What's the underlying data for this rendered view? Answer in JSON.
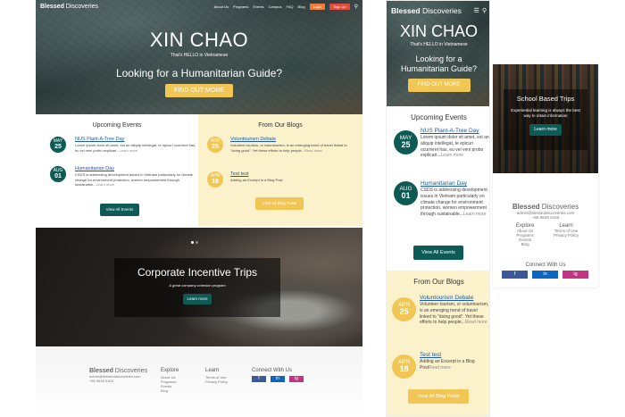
{
  "brand": {
    "bold": "Blessed",
    "light": " Discoveries"
  },
  "nav": {
    "items": [
      "About Us",
      "Programs",
      "Events",
      "Campus",
      "FAQ",
      "Blog"
    ],
    "login": "Login",
    "signup": "Sign Up"
  },
  "hero": {
    "title": "XIN CHAO",
    "subtitle": "That's HELLO in Vietnamese",
    "question": "Looking for a Humanitarian Guide?",
    "cta": "FIND OUT MORE"
  },
  "events": {
    "heading": "Upcoming Events",
    "items": [
      {
        "month": "MAY",
        "day": "25",
        "title": "NUS Plant-A-Tree Day",
        "text": "Lorem ipsum dolor sit amet, est an aliquip intellegat, te epicuri ocurreret has, eu vel veni probo explicari...",
        "more": "Learn more"
      },
      {
        "month": "AUG",
        "day": "01",
        "title": "Humanitarian Day",
        "text": "CSDS is addressing development issues in Vietnam particularly on climate change for environment protection, women empowerment through sustainable...",
        "more": "Learn more"
      }
    ],
    "view_all": "View All Events"
  },
  "blogs": {
    "heading": "From Our Blogs",
    "items": [
      {
        "month": "APR",
        "day": "25",
        "title": "Voluntourism Debate",
        "text": "Volunteer tourism, or voluntourism, is an emerging trend of travel linked to \"doing good\". Yet these efforts to help people...",
        "more": "Read more"
      },
      {
        "month": "APR",
        "day": "18",
        "title": "Test test",
        "text": "Adding an Excerpt in a Blog Post",
        "more": "Read more"
      }
    ],
    "view_all": "View All Blog Posts"
  },
  "corporate": {
    "title": "Corporate Incentive Trips",
    "subtitle": "A great company cohesion program",
    "button": "Learn more"
  },
  "school": {
    "title": "School Based Trips",
    "subtitle": "Experiential learning is always the best way to retain information",
    "button": "Learn more"
  },
  "footer": {
    "email": "admin@blesseddiscoveries.com",
    "phone": "+65 9648 5163",
    "explore_heading": "Explore",
    "explore_items": [
      "About Us",
      "Programs",
      "Events",
      "Blog"
    ],
    "learn_heading": "Learn",
    "learn_items": [
      "Terms of Use",
      "Privacy Policy"
    ],
    "connect_heading": "Connect With Us",
    "social": [
      "f",
      "in",
      "ig"
    ]
  },
  "colors": {
    "teal": "#0e5a54",
    "yellow": "#f2c655",
    "orange": "#ee7a3b",
    "red": "#e5493a",
    "link": "#1a5aa8"
  }
}
